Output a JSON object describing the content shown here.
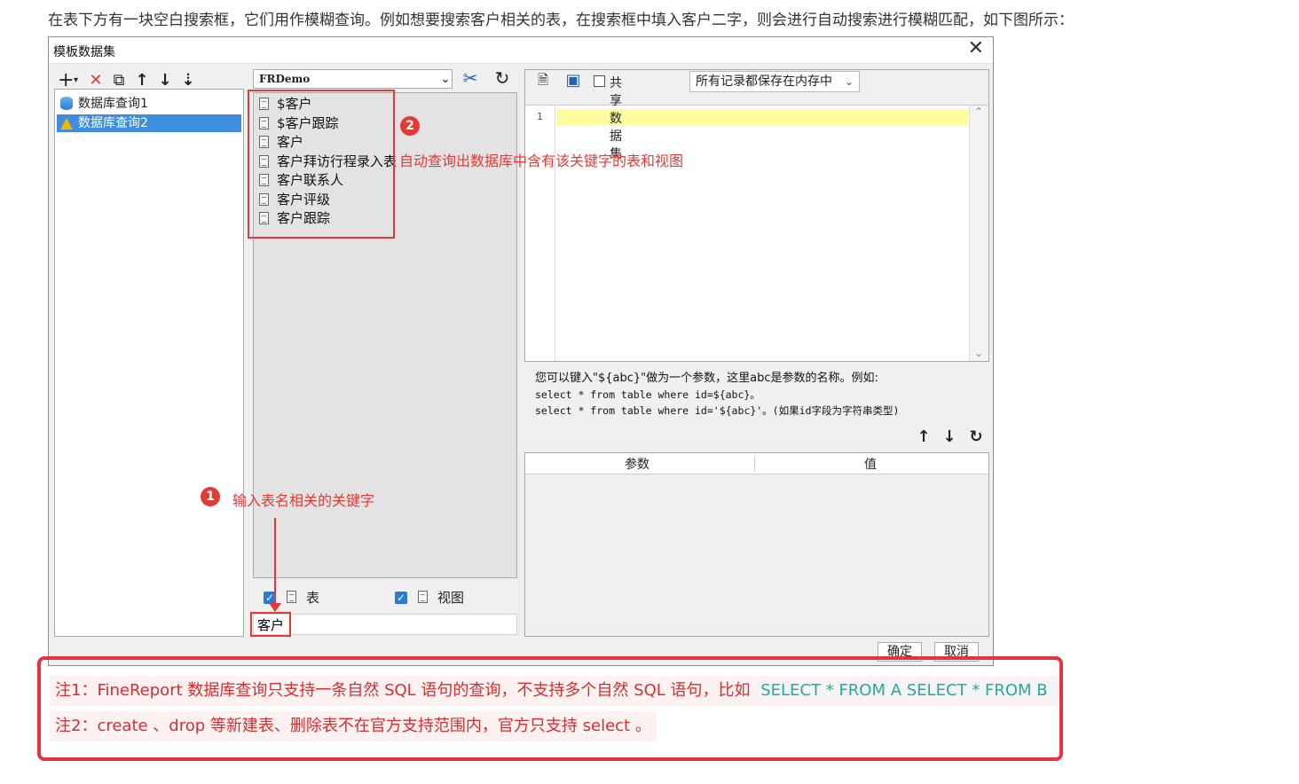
{
  "intro_text": "在表下方有一块空白搜索框，它们用作模糊查询。例如想要搜索客户相关的表，在搜索框中填入客户二字，则会进行自动搜索进行模糊匹配，如下图所示：",
  "dialog": {
    "title": "模板数据集",
    "close": "✕",
    "left_toolbar": {
      "add": "+",
      "add_arrow": "▾",
      "delete": "✕",
      "copy": "⧉",
      "up": "↑",
      "down": "↓",
      "sort": "⇣"
    },
    "datasets": [
      {
        "label": "数据库查询1",
        "icon": "database-icon",
        "selected": false
      },
      {
        "label": "数据库查询2",
        "icon": "warning-icon",
        "selected": true
      }
    ],
    "connection": {
      "value": "FRDemo",
      "arrow": "⌄",
      "edit_icon": "✂",
      "refresh_icon": "↻"
    },
    "tables": [
      "$客户",
      "$客户跟踪",
      "客户",
      "客户拜访行程录入表",
      "客户联系人",
      "客户评级",
      "客户跟踪"
    ],
    "filters": {
      "table_label": "表",
      "view_label": "视图",
      "check": "✓"
    },
    "search": {
      "value": "客户"
    },
    "right_toolbar": {
      "preview_icon": "🗎",
      "save_icon": "▣",
      "share_label": "共享数据集",
      "memory_option": "所有记录都保存在内存中",
      "arrow": "⌄"
    },
    "editor": {
      "line_number": "1",
      "scroll_up": "⌃",
      "scroll_down": "⌄"
    },
    "hint": {
      "line1": "您可以键入\"${abc}\"做为一个参数，这里abc是参数的名称。例如:",
      "line2": "select * from table where id=${abc}。",
      "line3": "select * from table where id='${abc}'。(如果id字段为字符串类型)"
    },
    "param_toolbar": {
      "up": "↑",
      "down": "↓",
      "refresh": "↻"
    },
    "param_table": {
      "col_param": "参数",
      "col_value": "值"
    },
    "buttons": {
      "ok": "确定",
      "cancel": "取消"
    }
  },
  "annotations": {
    "badge1": "1",
    "badge2": "2",
    "text1": "输入表名相关的关键字",
    "text2": "自动查询出数据库中含有该关键字的表和视图"
  },
  "notes": {
    "note1_text": "注1：FineReport 数据库查询只支持一条自然 SQL 语句的查询，不支持多个自然 SQL 语句，比如",
    "note1_code": "SELECT * FROM A SELECT * FROM B",
    "note2_text": "注2：create 、drop 等新建表、删除表不在官方支持范围内，官方只支持 select 。"
  }
}
